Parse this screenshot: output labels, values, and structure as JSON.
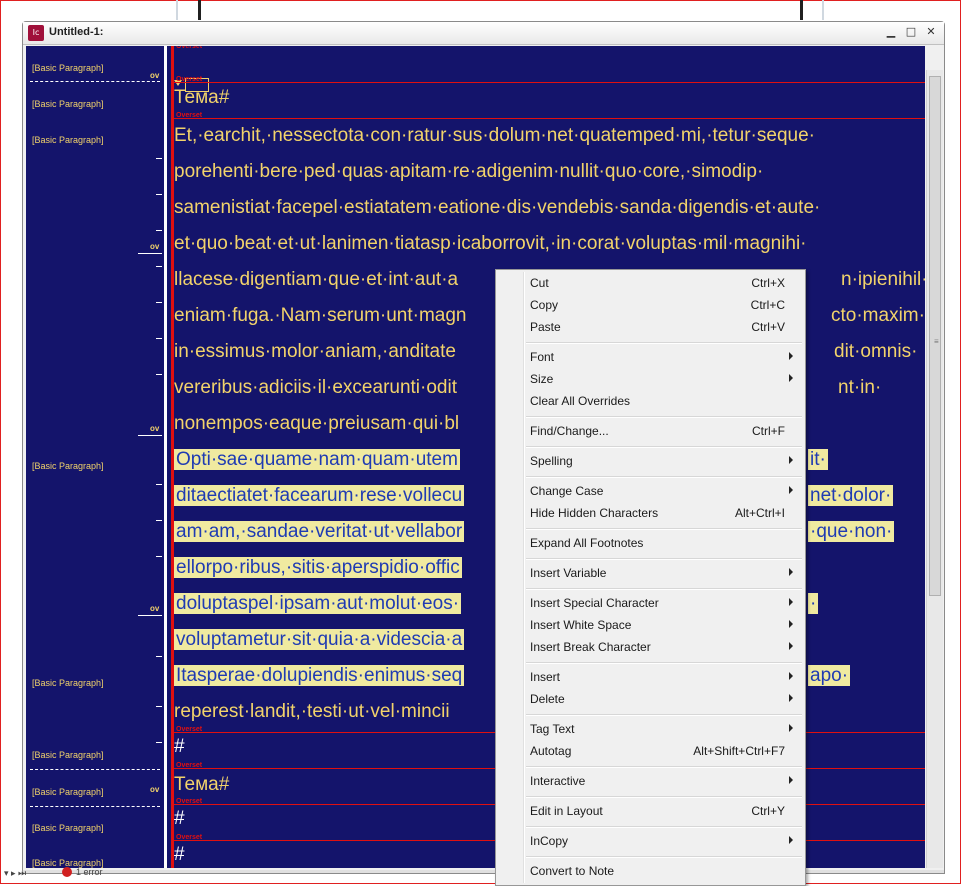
{
  "window": {
    "title": "Untitled-1:"
  },
  "gutter": {
    "styles": [
      {
        "label": "[Basic Paragraph]"
      },
      {
        "label": "[Basic Paragraph]"
      },
      {
        "label": "[Basic Paragraph]"
      },
      {
        "label": "[Basic Paragraph]"
      },
      {
        "label": "[Basic Paragraph]"
      },
      {
        "label": "[Basic Paragraph]"
      },
      {
        "label": "[Basic Paragraph]"
      },
      {
        "label": "[Basic Paragraph]"
      },
      {
        "label": "[Basic Paragraph]"
      }
    ],
    "ov_label": "ov"
  },
  "editor": {
    "overset_label": "Overset",
    "heading1": "Тема#",
    "body_lines": [
      "Et,·earchit,·nessectota·con·ratur·sus·dolum·net·quatemped·mi,·tetur·seque·",
      "porehenti·bere·ped·quas·apitam·re·adigenim·nullit·quo·core,·simodip·",
      "samenistiat·facepel·estiatatem·eatione·dis·vendebis·sanda·digendis·et·aute·",
      "et·quo·beat·et·ut·lanimen·tiatasp·icaborrovit,·in·corat·voluptas·mil·magnihi·",
      "llacese·digentiam·que·et·int·aut·a",
      "eniam·fuga.·Nam·serum·unt·magn",
      "in·essimus·molor·aniam,·anditate",
      "vereribus·adiciis·il·excearunti·odit",
      "nonempos·eaque·preiusam·qui·bl"
    ],
    "body_right": [
      "",
      "",
      "",
      "",
      "n·ipienihil·",
      "cto·maxim·",
      "dit·omnis·",
      "nt·in·",
      ""
    ],
    "sel_lines": [
      "Opti·sae·quame·nam·quam·utem",
      "ditaectiatet·facearum·rese·vollecu",
      "am·am,·sandae·veritat·ut·vellabor",
      "ellorpo·ribus,·sitis·aperspidio·offic",
      "doluptaspel·ipsam·aut·molut·eos·",
      "voluptametur·sit·quia·a·videscia·a",
      "Itasperae·dolupiendis·enimus·seq"
    ],
    "sel_right": [
      "it·",
      "net·dolor·",
      "·que·non·",
      "",
      "·",
      "",
      "apo·"
    ],
    "last_line": "reperest·landit,·testi·ut·vel·mincii",
    "hash": "#",
    "heading2": "Тема#"
  },
  "status": {
    "errors": "1 error"
  },
  "context_menu": {
    "items": [
      {
        "label": "Cut",
        "shortcut": "Ctrl+X"
      },
      {
        "label": "Copy",
        "shortcut": "Ctrl+C"
      },
      {
        "label": "Paste",
        "shortcut": "Ctrl+V"
      },
      {
        "label": "Font"
      },
      {
        "label": "Size"
      },
      {
        "label": "Clear All Overrides"
      },
      {
        "label": "Find/Change...",
        "shortcut": "Ctrl+F"
      },
      {
        "label": "Spelling"
      },
      {
        "label": "Change Case"
      },
      {
        "label": "Hide Hidden Characters",
        "shortcut": "Alt+Ctrl+I"
      },
      {
        "label": "Expand All Footnotes"
      },
      {
        "label": "Insert Variable"
      },
      {
        "label": "Insert Special Character"
      },
      {
        "label": "Insert White Space"
      },
      {
        "label": "Insert Break Character"
      },
      {
        "label": "Insert"
      },
      {
        "label": "Delete"
      },
      {
        "label": "Tag Text"
      },
      {
        "label": "Autotag",
        "shortcut": "Alt+Shift+Ctrl+F7"
      },
      {
        "label": "Interactive"
      },
      {
        "label": "Edit in Layout",
        "shortcut": "Ctrl+Y"
      },
      {
        "label": "InCopy"
      },
      {
        "label": "Convert to Note"
      }
    ]
  },
  "colors": {
    "editor_bg": "#14146b",
    "text_yellow": "#f2d36b",
    "selection_bg": "#f0eaa0",
    "selection_text": "#1f3bb3",
    "overset_red": "#e01010"
  }
}
